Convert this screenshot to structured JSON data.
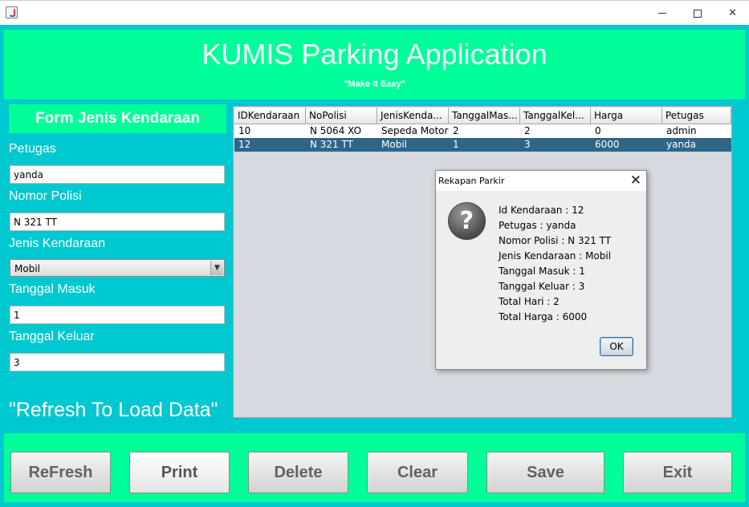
{
  "window": {
    "controls": [
      "minimize",
      "maximize",
      "close"
    ]
  },
  "header": {
    "title": "KUMIS Parking Application",
    "tagline": "\"Make It Easy\""
  },
  "form": {
    "title": "Form Jenis Kendaraan",
    "petugas_label": "Petugas",
    "petugas_value": "yanda",
    "nopol_label": "Nomor Polisi",
    "nopol_value": "N 321 TT",
    "jenis_label": "Jenis Kendaraan",
    "jenis_value": "Mobil",
    "masuk_label": "Tanggal Masuk",
    "masuk_value": "1",
    "keluar_label": "Tanggal Keluar",
    "keluar_value": "3",
    "refresh_hint": "\"Refresh To Load Data\""
  },
  "table": {
    "columns": [
      "IDKendaraan",
      "NoPolisi",
      "JenisKenda...",
      "TanggalMas...",
      "TanggalKel...",
      "Harga",
      "Petugas"
    ],
    "rows": [
      [
        "10",
        "N 5064 XO",
        "Sepeda Motor",
        "2",
        "2",
        "0",
        "admin"
      ],
      [
        "12",
        "N 321 TT",
        "Mobil",
        "1",
        "3",
        "6000",
        "yanda"
      ]
    ],
    "selected_row": 1
  },
  "dialog": {
    "title": "Rekapan Parkir",
    "icon": "question-icon",
    "lines": [
      "Id Kendaraan : 12",
      "Petugas : yanda",
      "Nomor Polisi : N 321 TT",
      "Jenis Kendaraan : Mobil",
      "Tanggal Masuk : 1",
      "Tanggal Keluar : 3",
      "Total Hari : 2",
      "Total Harga : 6000"
    ],
    "ok_label": "OK"
  },
  "buttons": {
    "refresh": "ReFresh",
    "print": "Print",
    "delete": "Delete",
    "clear": "Clear",
    "save": "Save",
    "exit": "Exit"
  },
  "colors": {
    "frame": "#00c8d0",
    "accent": "#00ff99",
    "selection": "#2f6589"
  }
}
